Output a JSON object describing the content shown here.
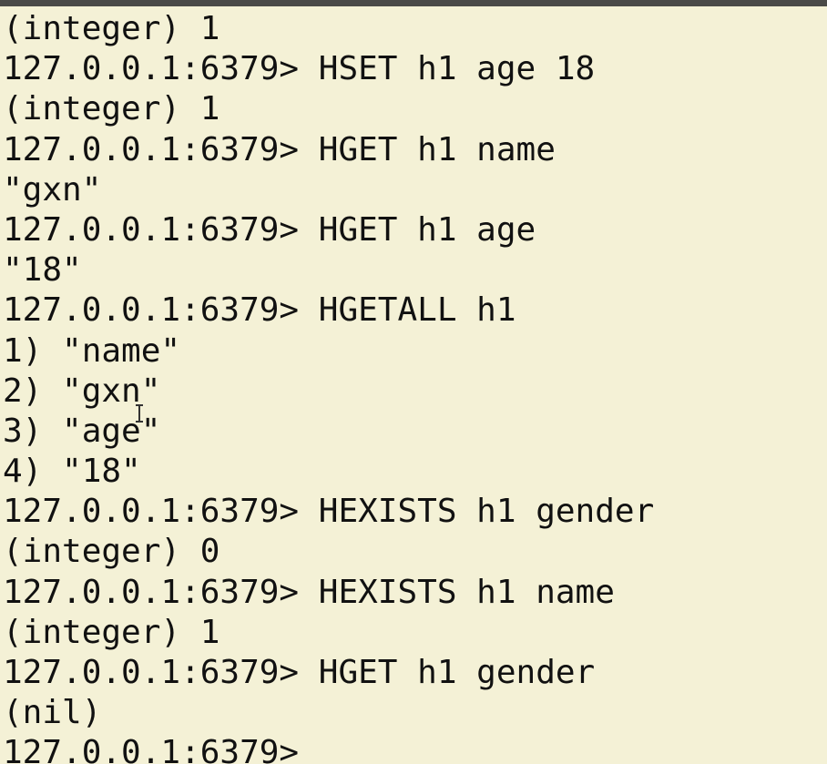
{
  "terminal": {
    "lines": [
      "(integer) 1",
      "127.0.0.1:6379> HSET h1 age 18",
      "(integer) 1",
      "127.0.0.1:6379> HGET h1 name",
      "\"gxn\"",
      "127.0.0.1:6379> HGET h1 age",
      "\"18\"",
      "127.0.0.1:6379> HGETALL h1",
      "1) \"name\"",
      "2) \"gxn\"",
      "3) \"age\"",
      "4) \"18\"",
      "127.0.0.1:6379> HEXISTS h1 gender",
      "(integer) 0",
      "127.0.0.1:6379> HEXISTS h1 name",
      "(integer) 1",
      "127.0.0.1:6379> HGET h1 gender",
      "(nil)",
      "127.0.0.1:6379>"
    ]
  },
  "colors": {
    "background": "#f4f1d6",
    "text": "#111111",
    "title_bar": "#4a4a48"
  },
  "icons": {
    "mouse_pointer": "i-beam-cursor-icon"
  }
}
